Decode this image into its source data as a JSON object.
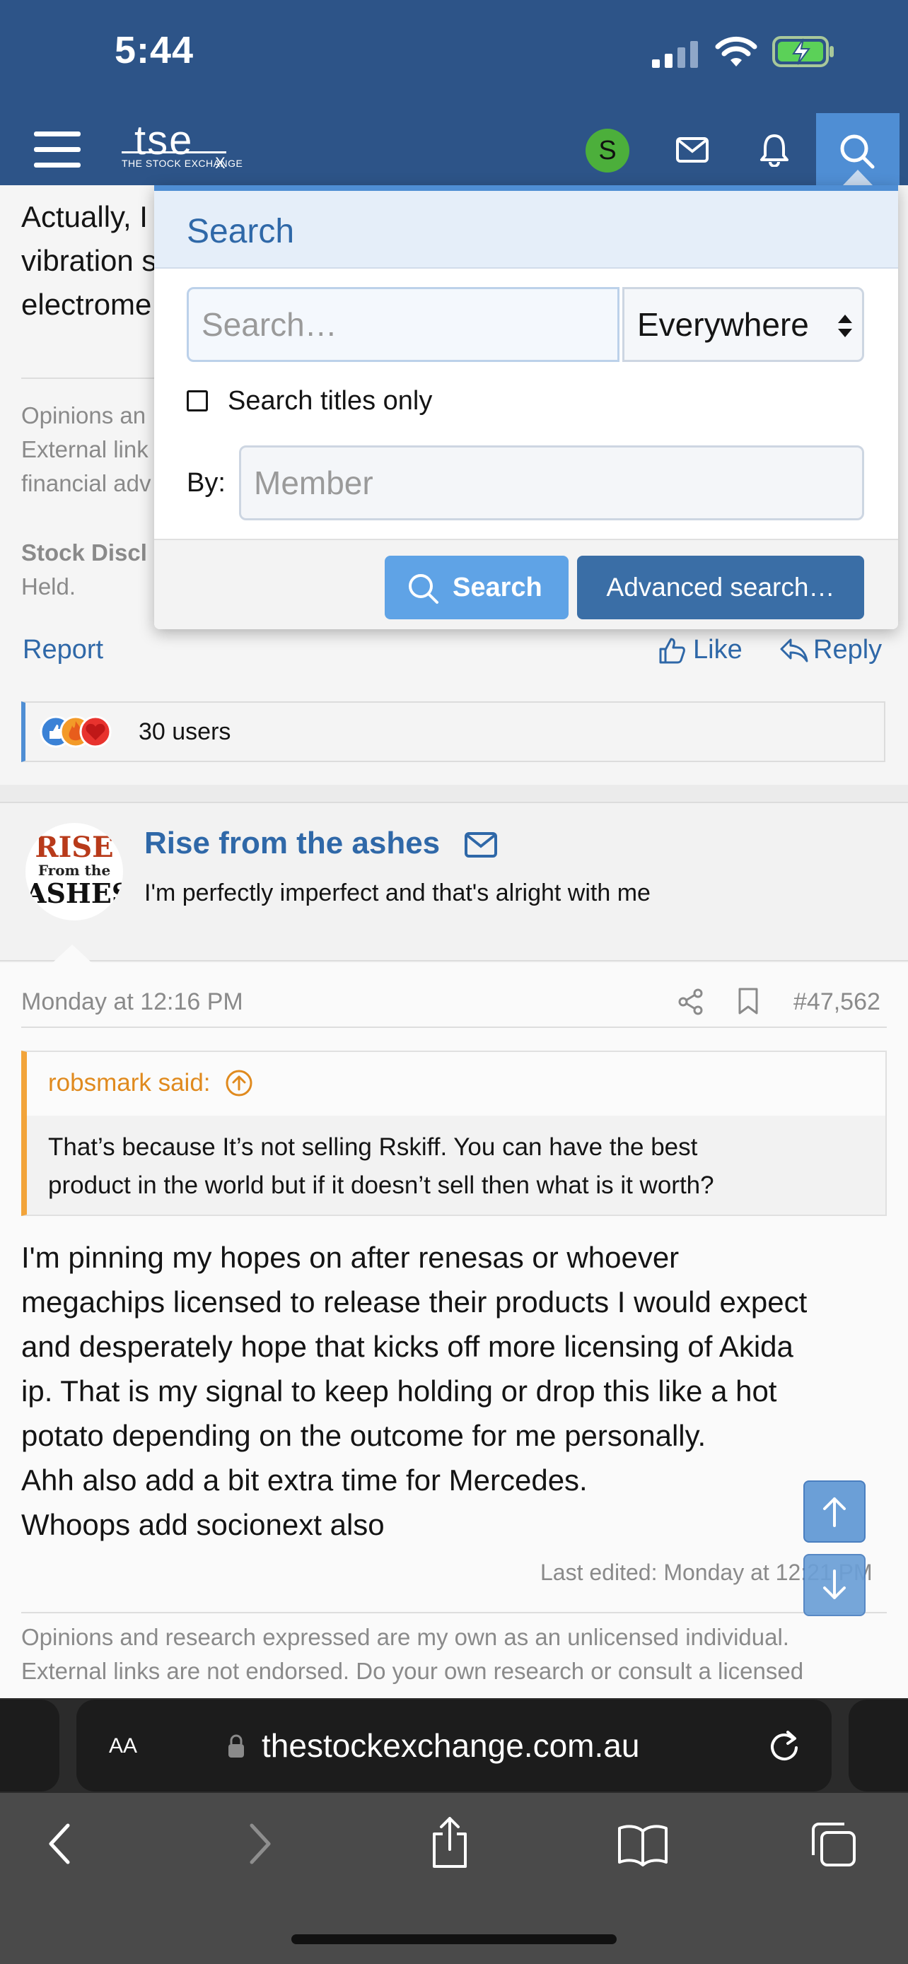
{
  "status_bar": {
    "time": "5:44"
  },
  "header": {
    "logo_text": "tse",
    "logo_subtitle": "THE STOCK EXCHANGE",
    "logo_x": "X",
    "avatar_letter": "S",
    "brand_color": "#2d5488",
    "accent_color": "#4f8ed4"
  },
  "search_menu": {
    "title": "Search",
    "search_placeholder": "Search…",
    "scope_value": "Everywhere",
    "titles_only_label": "Search titles only",
    "titles_only_checked": false,
    "by_label": "By:",
    "member_placeholder": "Member",
    "search_button": "Search",
    "advanced_button": "Advanced search…"
  },
  "post1": {
    "body_lines": [
      "Actually, I",
      "vibration s",
      "electrome"
    ],
    "signature_lines": [
      "Opinions an",
      "External link",
      "financial adv"
    ],
    "disclosure_label": "Stock Discl",
    "disclosure_value": "Held.",
    "report_label": "Report",
    "like_label": "Like",
    "reply_label": "Reply",
    "reactions_count": "30 users"
  },
  "post2": {
    "username": "Rise from the ashes",
    "avatar_lines": [
      "RISE",
      "From the",
      "ASHES"
    ],
    "user_title": "I'm perfectly imperfect and that's alright with me",
    "timestamp": "Monday at 12:16 PM",
    "post_number": "#47,562",
    "quote_author": "robsmark said:",
    "quote_lines": [
      "That’s because It’s not selling Rskiff. You can have the best",
      "product in the world but if it doesn’t sell then what is it worth?"
    ],
    "body_lines": [
      "I'm pinning my hopes on after renesas or whoever",
      "megachips licensed to release their products I would expect",
      "and desperately hope that kicks off more licensing of Akida",
      "ip. That is my signal to keep holding or drop this like a hot",
      "potato depending on the outcome for me personally.",
      "Ahh also add a bit extra time for Mercedes.",
      "Whoops add socionext also"
    ],
    "last_edited": "Last edited: Monday at 12:21 PM",
    "signature_lines": [
      "Opinions and research expressed are my own as an unlicensed individual.",
      "External links are not endorsed. Do your own research or consult a licensed"
    ]
  },
  "browser": {
    "text_size_label": "AA",
    "url": "thestockexchange.com.au"
  }
}
